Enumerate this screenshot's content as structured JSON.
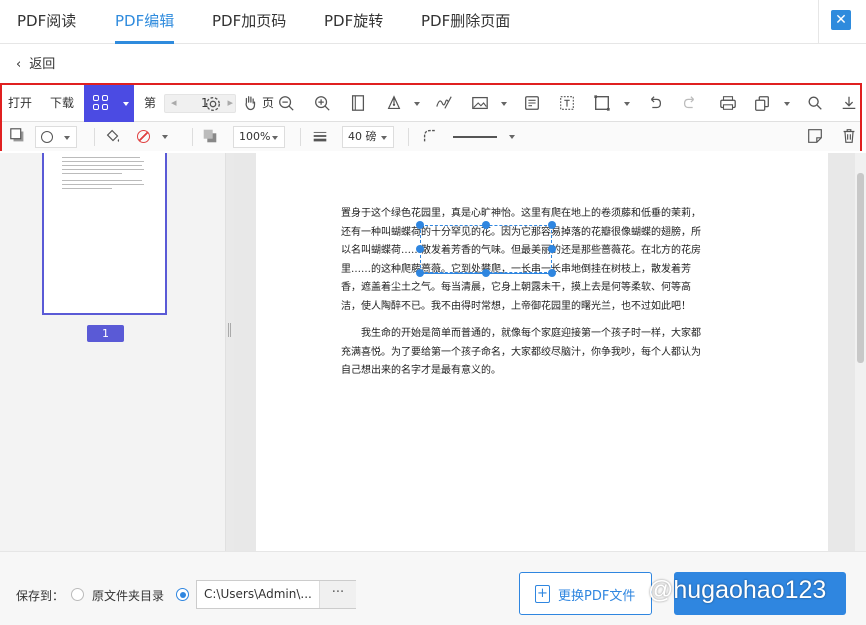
{
  "tabs": [
    {
      "label": "PDF阅读",
      "active": false
    },
    {
      "label": "PDF编辑",
      "active": true
    },
    {
      "label": "PDF加页码",
      "active": false
    },
    {
      "label": "PDF旋转",
      "active": false
    },
    {
      "label": "PDF删除页面",
      "active": false
    }
  ],
  "close_icon": "✕",
  "back": {
    "label": "返回"
  },
  "toolbar": {
    "open_label": "打开",
    "download_label": "下载",
    "page_prefix": "第",
    "page_value": "1",
    "page_suffix": "页",
    "opacity_value": "100%",
    "line_width_value": "40 磅",
    "accent_color": "#4b4be3",
    "highlight_border_color": "#e02020"
  },
  "thumbnail": {
    "page_number": "1"
  },
  "document": {
    "paragraph1": "置身于这个绿色花园里，真是心旷神怡。这里有爬在地上的卷须藤和低垂的茉莉，还有一种叫蝴蝶荷的十分罕见的花。因为它那容易掉落的花瓣很像蝴蝶的翅膀，所以名叫蝴蝶荷……散发着芳香的气味。但最美丽的还是那些蔷薇花。在北方的花房里……的这种爬藤蔷薇。它到处攀爬，一长串一长串地倒挂在树枝上，散发着芳香，遮盖着尘土之气。每当清晨，它身上朝露未干，摸上去是何等柔软、何等高洁，使人陶醉不已。我不由得时常想，上帝御花园里的曙光兰，也不过如此吧！",
    "paragraph2": "我生命的开始是简单而普通的，就像每个家庭迎接第一个孩子时一样，大家都充满喜悦。为了要给第一个孩子命名，大家都绞尽脑汁，你争我吵，每个人都认为自己想出来的名字才是最有意义的。"
  },
  "footer": {
    "save_to_label": "保存到：",
    "option_original_folder": "原文件夹目录",
    "path_value": "C:\\Users\\Admin\\...",
    "browse_label": "···",
    "replace_button_label": "更换PDF文件",
    "replace_icon": "+"
  },
  "watermark": "@hugaohao123"
}
